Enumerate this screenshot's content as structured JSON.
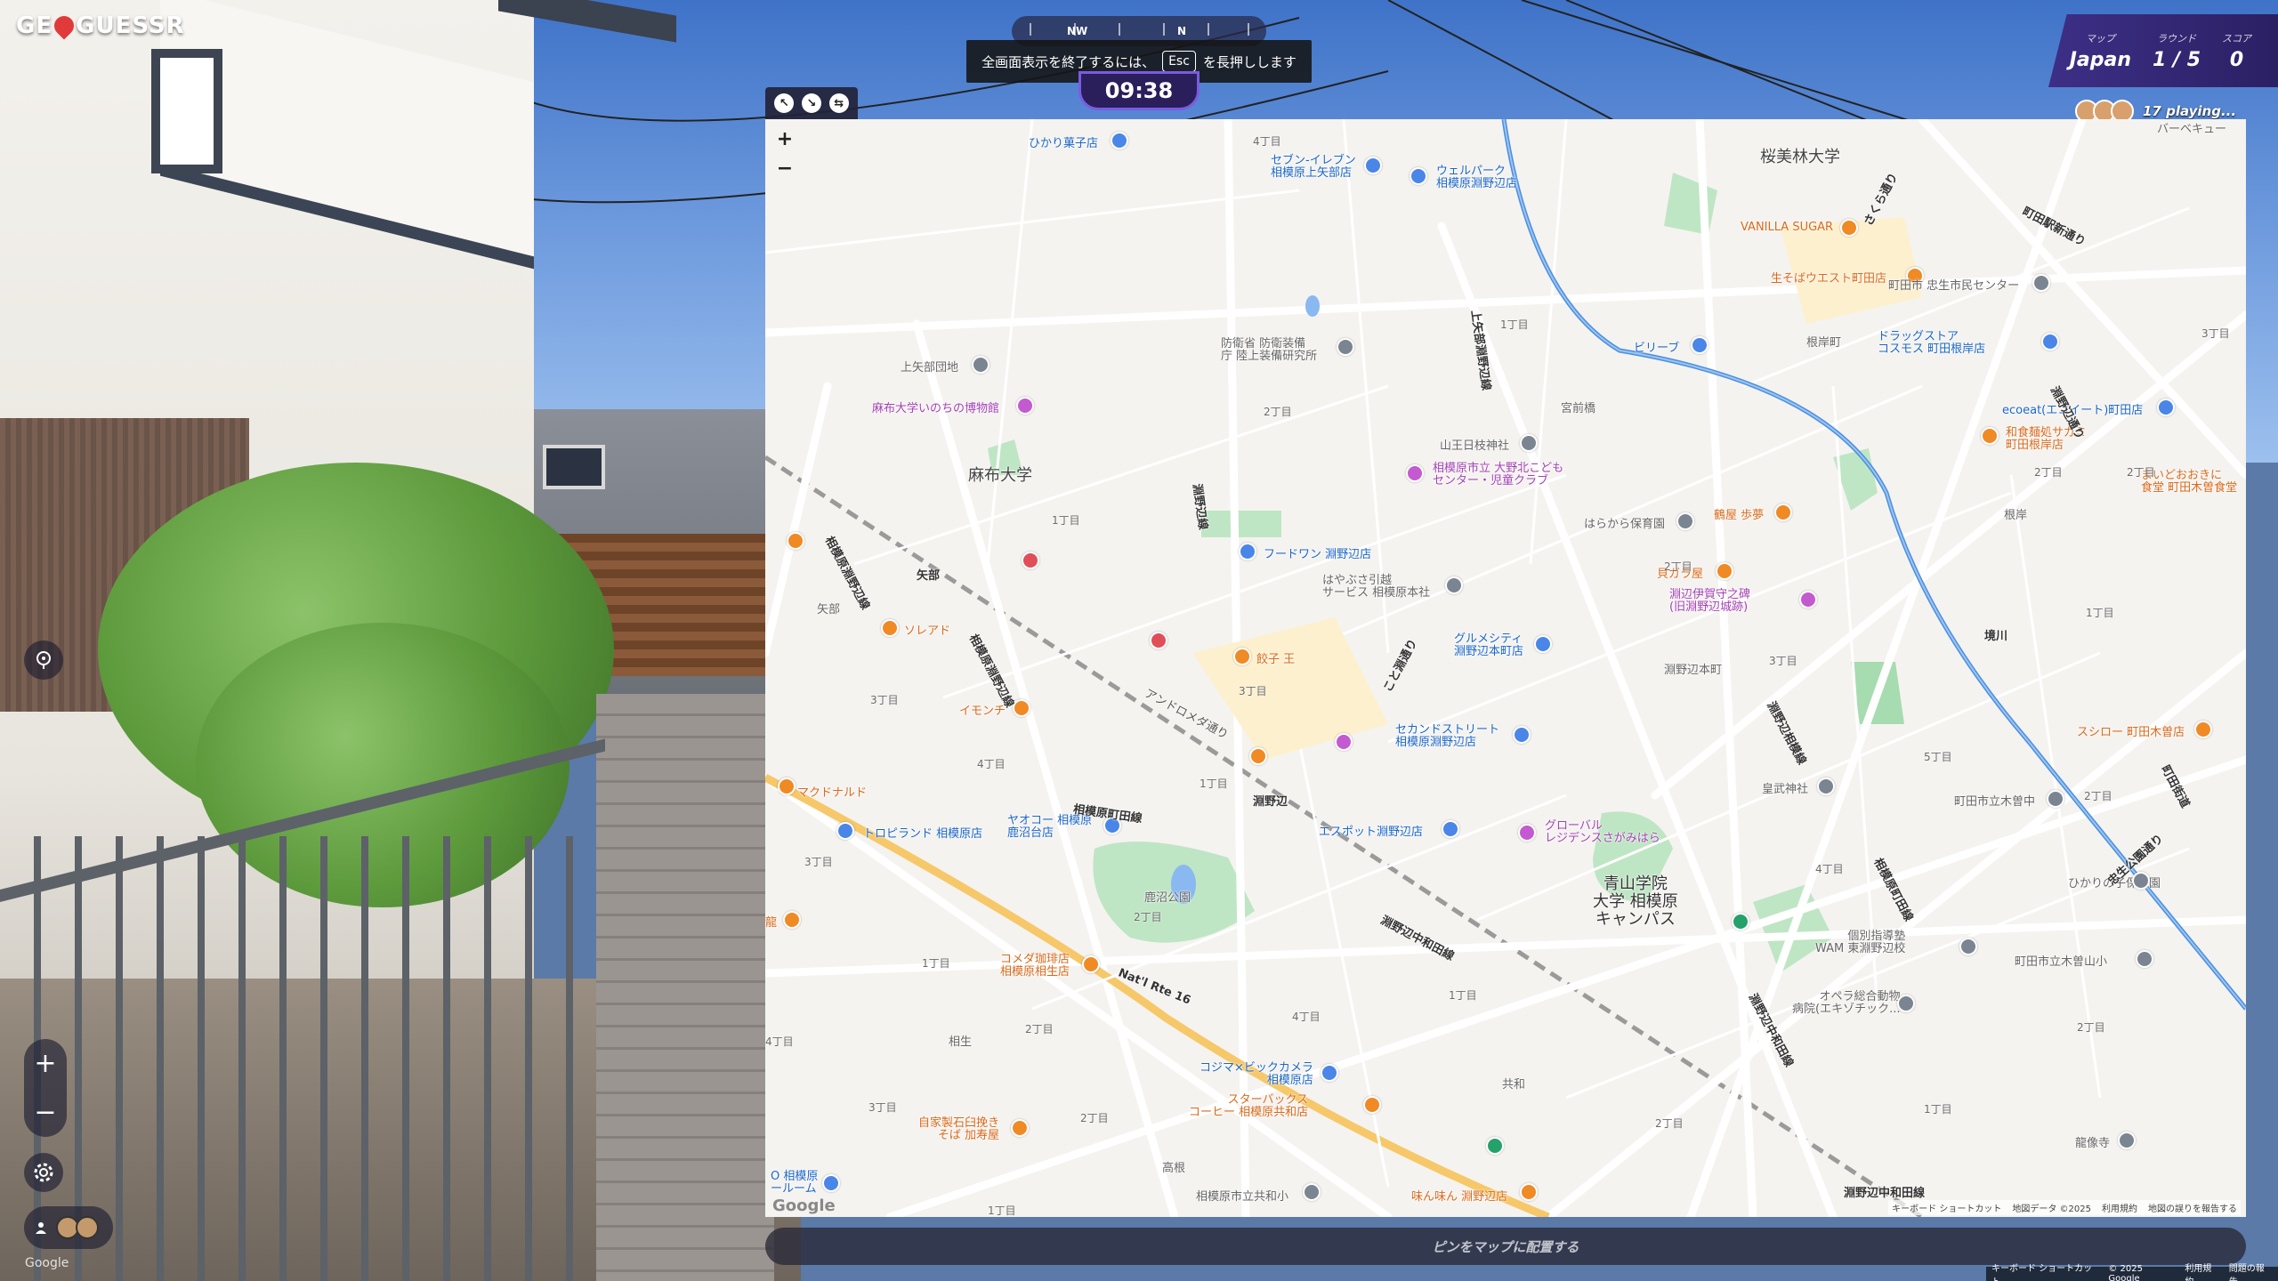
{
  "logo": {
    "text_before": "GE",
    "text_after": "GUESSR"
  },
  "compass": {
    "labels": [
      "NW",
      "N"
    ]
  },
  "esc_toast": {
    "before": "全画面表示を終了するには、",
    "key": "Esc",
    "after": "を長押しします"
  },
  "timer": "09:38",
  "status": {
    "map_label": "マップ",
    "map_value": "Japan",
    "round_label": "ラウンド",
    "round_value": "1 / 5",
    "score_label": "スコア",
    "score_value": "0"
  },
  "playing": "17 playing...",
  "map": {
    "zoom_in": "+",
    "zoom_out": "−",
    "google": "Google",
    "attribution": [
      "キーボード ショートカット",
      "地図データ ©2025",
      "利用規約",
      "地図の誤りを報告する"
    ],
    "labels": {
      "hikari": "ひかり菓子店",
      "seven": "セブン-イレブン\n相模原上矢部店",
      "welpark": "ウェルパーク\n相模原淵野辺店",
      "ouberin": "桜美林大学",
      "vanilla": "VANILLA SUGAR",
      "kisoba": "生そばウエスト町田店",
      "chuseikan": "町田市 忠生市民センター",
      "kamiyabe": "上矢部団地",
      "boueisho": "防衛省 防衛装備\n庁 陸上装備研究所",
      "biliebu": "ビリーブ",
      "drugstore": "ドラッグストア\nコスモス 町田根岸店",
      "negishicho": "根岸町",
      "ecoeat": "ecoeat(エコイート)町田店",
      "azabu_museum": "麻布大学いのちの博物館",
      "miyamae": "宮前橋",
      "yamaou": "山王日枝神社",
      "wagashi": "和食麺処サガミ\n町田根岸店",
      "azabu_univ": "麻布大学",
      "kodomo": "相模原市立 大野北こども\nセンター・児童クラブ",
      "maido": "まいどおおきに\n食堂 町田木曽食堂",
      "harakara": "はらから保育園",
      "negishi": "根岸",
      "foodone": "フードワン 淵野辺店",
      "tsurumi": "鶴屋 歩夢",
      "yabe_station": "矢部",
      "hayabusa": "はやぶさ引越\nサービス 相模原本社",
      "kaigara": "貝ガラ屋",
      "fuchinobe_ruins": "淵辺伊賀守之碑\n(旧淵野辺城跡)",
      "yabe": "矢部",
      "soreado": "ソレアド",
      "gourmet": "グルメシティ\n淵野辺本町店",
      "gyoza": "餃子 王",
      "fuchinobehoncho": "淵野辺本町",
      "imonchi": "イモンチ",
      "second_street": "セカンドストリート\n相模原淵野辺店",
      "sushiro": "スシロー 町田木曽店",
      "mcdonalds": "マクドナルド",
      "fuchinobe_station": "淵野辺",
      "kobu": "皇武神社",
      "machida_kiso_jh": "町田市立木曽中",
      "toys": "トロピランド 相模原店",
      "yaokoh": "ヤオコー 相模原\n鹿沼台店",
      "espot": "エスポット淵野辺店",
      "global": "グローバル\nレジデンスさがみはら",
      "hikarino": "ひかりの子保育園",
      "kanuma_park": "鹿沼公園",
      "aoyama": "青山学院\n大学 相模原\nキャンパス",
      "kobetsu": "個別指導塾\nWAM 東淵野辺校",
      "machida_kiso_es": "町田市立木曽山小",
      "komeda": "コメダ珈琲店\n相模原相生店",
      "opera": "オペラ総合動物\n病院(エキゾチック...",
      "aioi": "相生",
      "kojima": "コジマ×ビックカメラ\n相模原店",
      "starbucks": "スターバックス\nコーヒー 相模原共和店",
      "kyowa": "共和",
      "ryuzoji": "龍像寺",
      "jikasei": "自家製石臼挽き\nそば 加寿屋",
      "takane": "高根",
      "kyowa_es": "相模原市立共和小",
      "minmin": "味ん味ん 淵野辺店",
      "sagamihara_room": "O 相模原\nールーム",
      "rte16": "Nat'l Rte 16",
      "bbq": "バーベキュー",
      "oe": "龍"
    },
    "roads": [
      "相模原淵野辺線",
      "淵野辺通り",
      "上矢部淵野辺線",
      "淵野辺線",
      "町田駅新通り",
      "忠生公園通り",
      "淵野辺中和田線",
      "相模原町田線",
      "こと淵通り",
      "町田街道",
      "境川",
      "淵野辺相模線",
      "アンドロメダ通り",
      "共和",
      "さくら通り"
    ],
    "districts": [
      "4丁目",
      "1丁目",
      "2丁目",
      "3丁目",
      "5丁目"
    ]
  },
  "place_pin": "ピンをマップに配置する",
  "bottom_attrib": [
    "キーボード ショートカット",
    "© 2025 Google",
    "利用規約",
    "問題の報告"
  ],
  "colors": {
    "accent": "#3d2f86",
    "timer_border": "#7b5be0",
    "road_major": "#f6c86a",
    "park": "#a6dcb0",
    "river": "#4a8fe0"
  }
}
